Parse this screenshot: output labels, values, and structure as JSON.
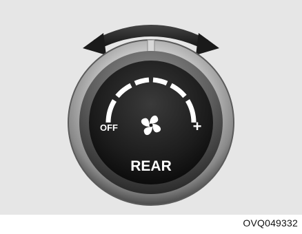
{
  "knob": {
    "off_label": "OFF",
    "plus_label": "+",
    "name_label": "REAR",
    "fan_icon": "fan-icon",
    "rotate_arrow_icon": "double-headed-curved-arrow-icon",
    "level_segments_total": 6
  },
  "caption": {
    "code": "OVQ049332"
  },
  "colors": {
    "panel_background": "#e6e6e6",
    "knob_face": "#1c1c1c",
    "indicator": "#ffffff",
    "arrow": "#222222"
  }
}
